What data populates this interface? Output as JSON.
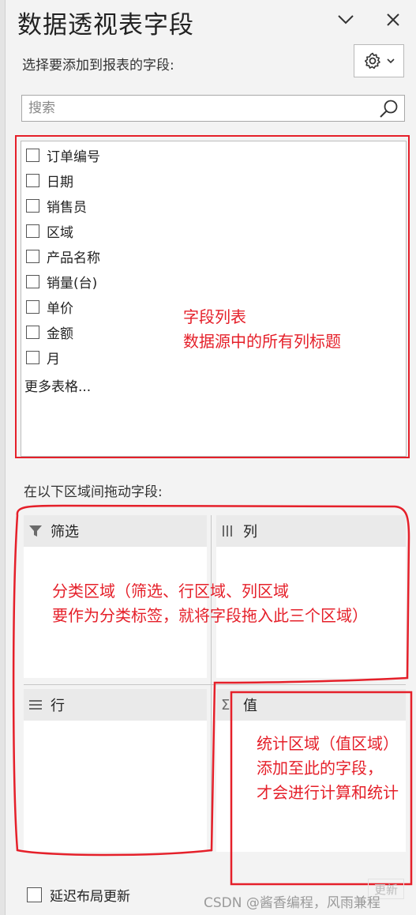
{
  "header": {
    "title": "数据透视表字段",
    "subtitle": "选择要添加到报表的字段:"
  },
  "search": {
    "placeholder": "搜索",
    "value": ""
  },
  "fields": [
    {
      "label": "订单编号",
      "checked": false
    },
    {
      "label": "日期",
      "checked": false
    },
    {
      "label": "销售员",
      "checked": false
    },
    {
      "label": "区域",
      "checked": false
    },
    {
      "label": "产品名称",
      "checked": false
    },
    {
      "label": "销量(台)",
      "checked": false
    },
    {
      "label": "单价",
      "checked": false
    },
    {
      "label": "金额",
      "checked": false
    },
    {
      "label": "月",
      "checked": false
    }
  ],
  "more_tables": "更多表格...",
  "drag_label": "在以下区域间拖动字段:",
  "areas": {
    "filter": "筛选",
    "columns": "列",
    "rows": "行",
    "values": "值"
  },
  "annotations": {
    "field_list_line1": "字段列表",
    "field_list_line2": "数据源中的所有列标题",
    "category_line1": "分类区域（筛选、行区域、列区域",
    "category_line2": "要作为分类标签，就将字段拖入此三个区域）",
    "stats_line1": "统计区域（值区域）",
    "stats_line2": "添加至此的字段，",
    "stats_line3": "才会进行计算和统计"
  },
  "footer": {
    "defer_label": "延迟布局更新",
    "update_label": "更新",
    "watermark": "CSDN @酱香编程，风雨兼程"
  },
  "colors": {
    "annotation_red": "#e5202a",
    "pane_bg": "#f3f3f3",
    "area_header_bg": "#eaeaea"
  },
  "icons": [
    "chevron-down-icon",
    "close-icon",
    "gear-icon",
    "search-icon",
    "filter-icon",
    "columns-icon",
    "rows-icon",
    "sigma-icon"
  ]
}
